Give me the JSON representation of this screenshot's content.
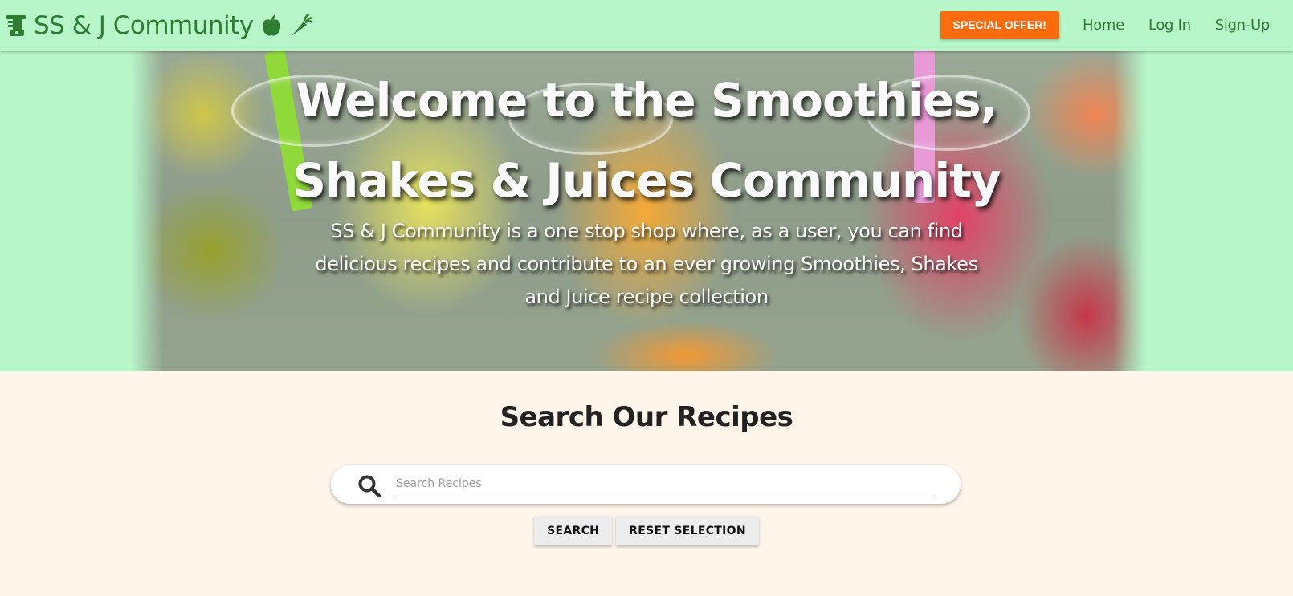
{
  "navbar": {
    "brand": "SS & J Community",
    "icons": [
      "blender-icon",
      "apple-icon",
      "carrot-icon"
    ],
    "special_offer": "SPECIAL OFFER!",
    "links": [
      "Home",
      "Log In",
      "Sign-Up"
    ],
    "colors": {
      "background": "#b7f6c9",
      "text": "#2e7d32",
      "offer": "#fc6b0c"
    }
  },
  "hero": {
    "title_line1": "Welcome to the Smoothies,",
    "title_line2": "Shakes & Juices Community",
    "description": "SS & J Community is a one stop shop where, as a user, you can find delicious recipes and contribute to an ever growing Smoothies, Shakes and Juice recipe collection"
  },
  "search": {
    "title": "Search Our Recipes",
    "placeholder": "Search Recipes",
    "value": "",
    "search_button": "SEARCH",
    "reset_button": "RESET SELECTION"
  }
}
